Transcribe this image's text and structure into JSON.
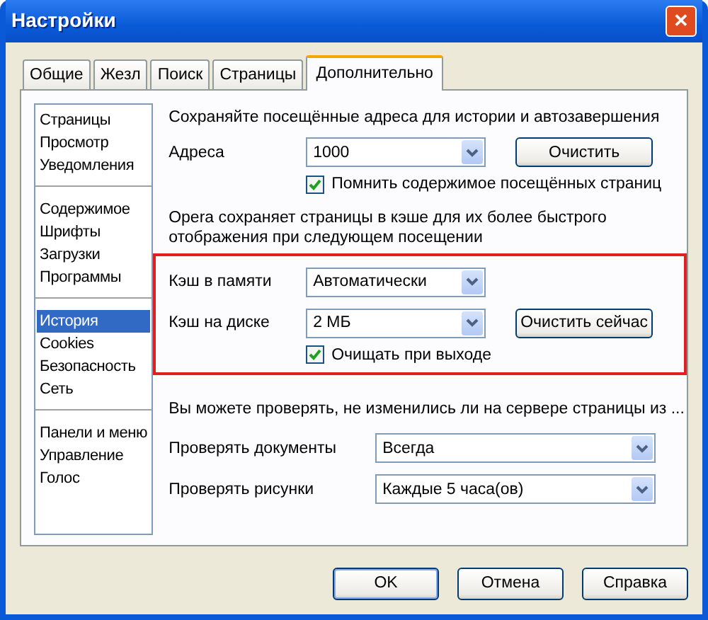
{
  "window": {
    "title": "Настройки",
    "close": "✕"
  },
  "tabs": [
    {
      "label": "Общие",
      "selected": false
    },
    {
      "label": "Жезл",
      "selected": false
    },
    {
      "label": "Поиск",
      "selected": false
    },
    {
      "label": "Страницы",
      "selected": false
    },
    {
      "label": "Дополнительно",
      "selected": true
    }
  ],
  "sidebar": {
    "groups": [
      [
        {
          "label": "Страницы",
          "selected": false
        },
        {
          "label": "Просмотр",
          "selected": false
        },
        {
          "label": "Уведомления",
          "selected": false
        }
      ],
      [
        {
          "label": "Содержимое",
          "selected": false
        },
        {
          "label": "Шрифты",
          "selected": false
        },
        {
          "label": "Загрузки",
          "selected": false
        },
        {
          "label": "Программы",
          "selected": false
        }
      ],
      [
        {
          "label": "История",
          "selected": true
        },
        {
          "label": "Cookies",
          "selected": false
        },
        {
          "label": "Безопасность",
          "selected": false
        },
        {
          "label": "Сеть",
          "selected": false
        }
      ],
      [
        {
          "label": "Панели и меню",
          "selected": false
        },
        {
          "label": "Управление",
          "selected": false
        },
        {
          "label": "Голос",
          "selected": false
        }
      ]
    ]
  },
  "history": {
    "intro": "Сохраняйте посещённые адреса для истории и автозавершения",
    "address": {
      "label": "Адреса",
      "value": "1000",
      "button": "Очистить"
    },
    "remember": {
      "label": "Помнить содержимое посещённых страниц",
      "checked": true
    },
    "cache_note": "Opera сохраняет страницы в кэше для их более быстрого отображения при следующем посещении",
    "cache": {
      "highlighted": true,
      "memory": {
        "label": "Кэш в памяти",
        "value": "Автоматически"
      },
      "disk": {
        "label": "Кэш на диске",
        "value": "2 МБ",
        "button": "Очистить сейчас"
      },
      "clear_on_exit": {
        "label": "Очищать при выходе",
        "checked": true
      }
    },
    "check_note": "Вы можете проверять, не изменились ли на сервере страницы из ...",
    "checks": [
      {
        "label": "Проверять документы",
        "value": "Всегда"
      },
      {
        "label": "Проверять рисунки",
        "value": "Каждые 5 часа(ов)"
      }
    ]
  },
  "buttons": [
    {
      "label": "OK",
      "default": true
    },
    {
      "label": "Отмена",
      "default": false
    },
    {
      "label": "Справка",
      "default": false
    }
  ]
}
